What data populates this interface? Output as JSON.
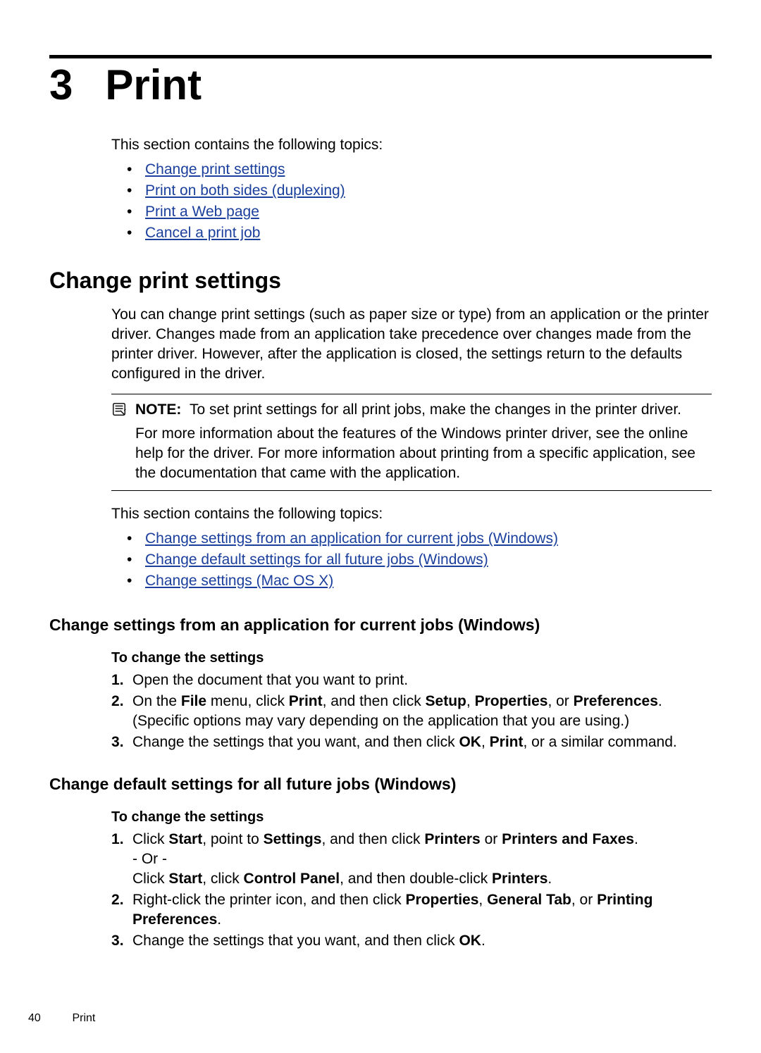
{
  "chapter": {
    "number": "3",
    "title": "Print"
  },
  "intro": "This section contains the following topics:",
  "toc": [
    "Change print settings",
    "Print on both sides (duplexing)",
    "Print a Web page",
    "Cancel a print job"
  ],
  "section1": {
    "heading": "Change print settings",
    "body": "You can change print settings (such as paper size or type) from an application or the printer driver. Changes made from an application take precedence over changes made from the printer driver. However, after the application is closed, the settings return to the defaults configured in the driver.",
    "note": {
      "label": "NOTE:",
      "line1": "To set print settings for all print jobs, make the changes in the printer driver.",
      "line2": "For more information about the features of the Windows printer driver, see the online help for the driver. For more information about printing from a specific application, see the documentation that came with the application."
    },
    "intro2": "This section contains the following topics:",
    "toc2": [
      "Change settings from an application for current jobs (Windows)",
      "Change default settings for all future jobs (Windows)",
      "Change settings (Mac OS X)"
    ]
  },
  "sub1": {
    "heading": "Change settings from an application for current jobs (Windows)",
    "proc_title": "To change the settings",
    "steps": {
      "s1": "Open the document that you want to print.",
      "s2a": "On the ",
      "s2b": "File",
      "s2c": " menu, click ",
      "s2d": "Print",
      "s2e": ", and then click ",
      "s2f": "Setup",
      "s2g": ", ",
      "s2h": "Properties",
      "s2i": ", or ",
      "s2j": "Preferences",
      "s2k": ". (Specific options may vary depending on the application that you are using.)",
      "s3a": "Change the settings that you want, and then click ",
      "s3b": "OK",
      "s3c": ", ",
      "s3d": "Print",
      "s3e": ", or a similar command."
    }
  },
  "sub2": {
    "heading": "Change default settings for all future jobs (Windows)",
    "proc_title": "To change the settings",
    "steps": {
      "s1a": "Click ",
      "s1b": "Start",
      "s1c": ", point to ",
      "s1d": "Settings",
      "s1e": ", and then click ",
      "s1f": "Printers",
      "s1g": " or ",
      "s1h": "Printers and Faxes",
      "s1i": ".",
      "s1or": "- Or -",
      "s1j": "Click ",
      "s1k": "Start",
      "s1l": ", click ",
      "s1m": "Control Panel",
      "s1n": ", and then double-click ",
      "s1o": "Printers",
      "s1p": ".",
      "s2a": "Right-click the printer icon, and then click ",
      "s2b": "Properties",
      "s2c": ", ",
      "s2d": "General Tab",
      "s2e": ", or ",
      "s2f": "Printing Preferences",
      "s2g": ".",
      "s3a": "Change the settings that you want, and then click ",
      "s3b": "OK",
      "s3c": "."
    }
  },
  "footer": {
    "page": "40",
    "chapter": "Print"
  }
}
